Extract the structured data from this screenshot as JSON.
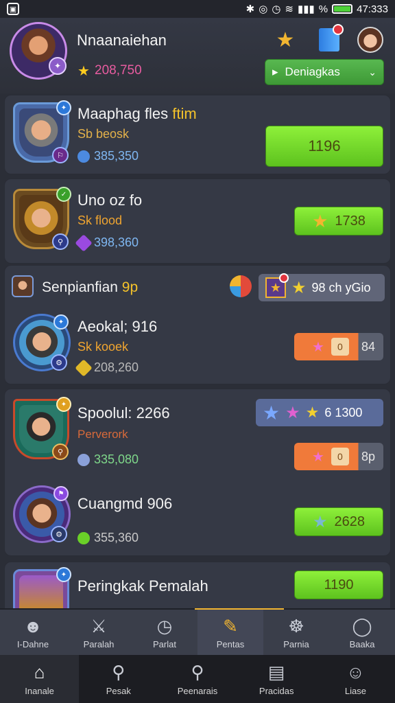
{
  "status_bar": {
    "left_icon": "notification-icon",
    "icons": [
      "bluetooth-icon",
      "alarm-icon",
      "wifi-icon",
      "signal-icon"
    ],
    "battery_label": "%",
    "battery_level": 1.0,
    "time": "47:333"
  },
  "header": {
    "player_name": "Nnaanaiehan",
    "coins": "208,750",
    "dropdown_label": "Deniagkas"
  },
  "cards": [
    {
      "title": "Maaphag fles",
      "title_accent": "ftim",
      "sub": "Sb beosk",
      "stat": "385,350",
      "stat_color": "#7fb7f2",
      "gem_color": "#4c8ae0",
      "button_value": "1196"
    },
    {
      "title": "Uno oz fo",
      "sub": "Sk flood",
      "stat": "398,360",
      "stat_color": "#7fb7f2",
      "gem_color": "#9a4ae0",
      "button_value": "1738"
    },
    {
      "header_title": "Senpianfian",
      "header_accent": "9p",
      "header_pill": "98 ch yGio",
      "title": "Aeokal; 916",
      "sub": "Sk kooek",
      "stat": "208,260",
      "stat_color": "#7fb7f2",
      "gem_color": "#e0b828",
      "button_value": "84"
    },
    {
      "title": "Spoolul: 2266",
      "sub": "Perverork",
      "stat": "335,080",
      "stat_color": "#7fd88a",
      "gem_color": "#8aa0d8",
      "pill_value": "6 1300",
      "button_value": "8p"
    },
    {
      "title": "Cuangmd 906",
      "stat": "355,360",
      "stat_color": "#c8c8c8",
      "gem_color": "#6ad028",
      "button_value": "2628"
    },
    {
      "title": "Peringkak Pemalah",
      "button_value": "1190"
    }
  ],
  "tabs": [
    {
      "label": "I-Dahne",
      "icon": "hero-icon"
    },
    {
      "label": "Paralah",
      "icon": "swords-icon"
    },
    {
      "label": "Parlat",
      "icon": "clock-icon"
    },
    {
      "label": "Pentas",
      "icon": "ticket-icon"
    },
    {
      "label": "Parnia",
      "icon": "group-icon"
    },
    {
      "label": "Baaka",
      "icon": "chat-icon"
    }
  ],
  "nav": [
    {
      "label": "Inanale",
      "icon": "home-icon"
    },
    {
      "label": "Pesak",
      "icon": "search-icon"
    },
    {
      "label": "Peenarais",
      "icon": "search-people-icon"
    },
    {
      "label": "Pracidas",
      "icon": "document-icon"
    },
    {
      "label": "Liase",
      "icon": "profile-icon"
    }
  ]
}
